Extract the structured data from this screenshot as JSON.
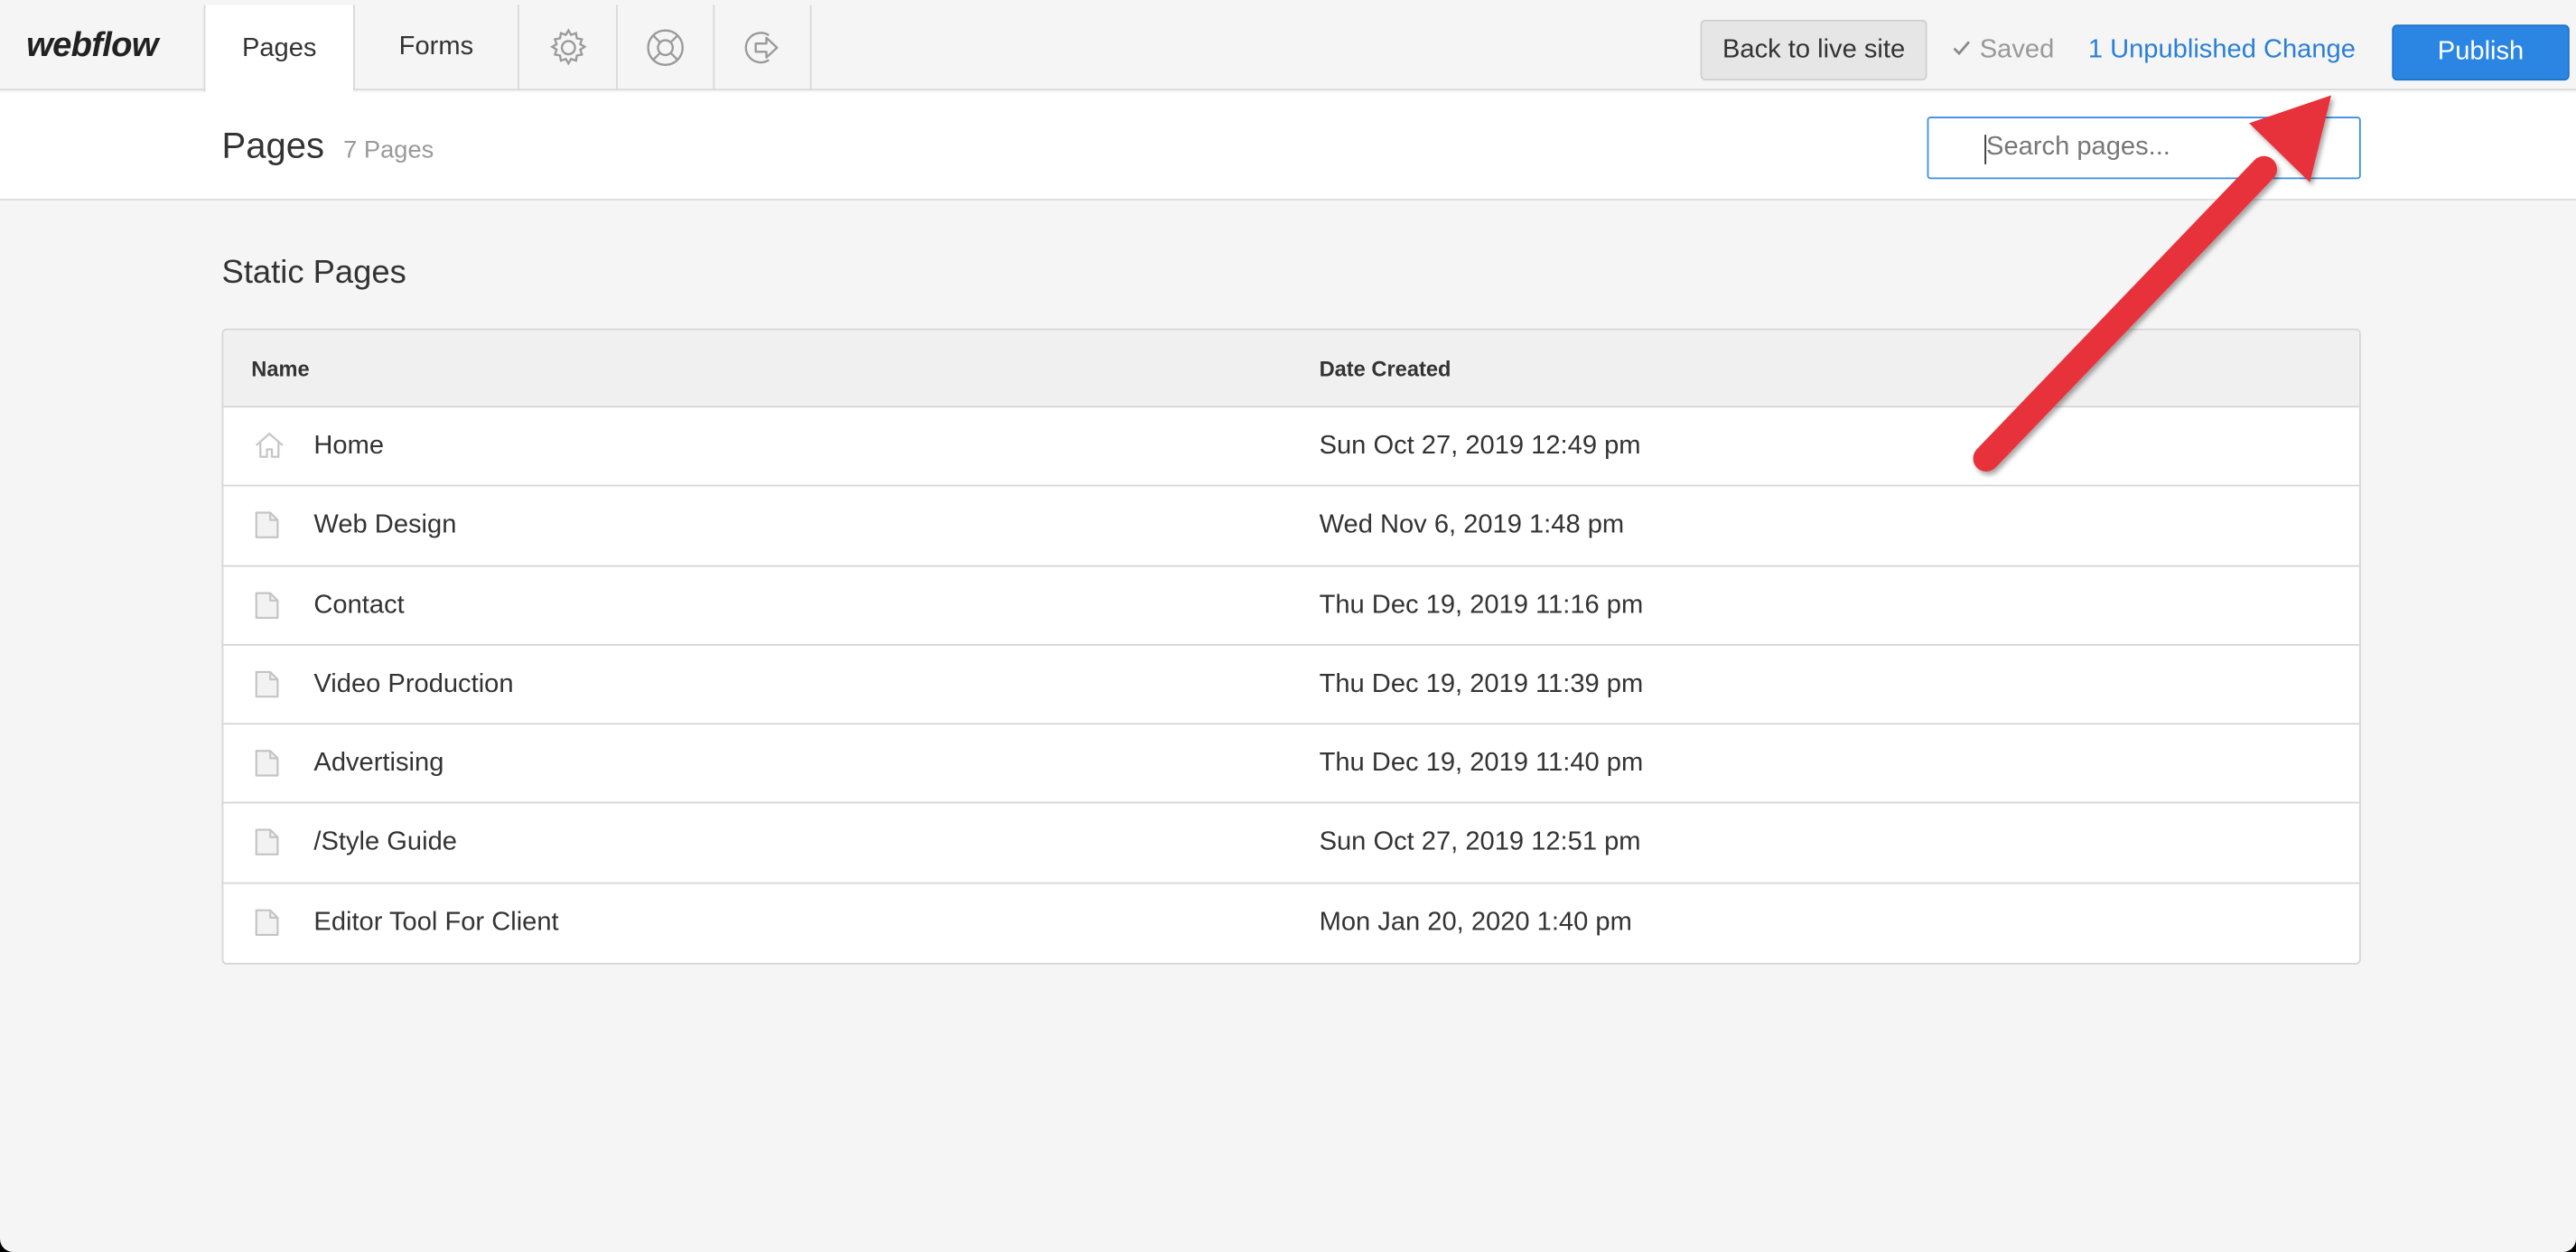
{
  "topbar": {
    "logo": "webflow",
    "tabs": [
      {
        "label": "Pages",
        "active": true
      },
      {
        "label": "Forms",
        "active": false
      }
    ],
    "icon_tabs": [
      "gear-icon",
      "lifebuoy-icon",
      "exit-icon"
    ],
    "back_label": "Back to live site",
    "saved_label": "Saved",
    "unpublished_label": "1 Unpublished Change",
    "publish_label": "Publish"
  },
  "header": {
    "title": "Pages",
    "count": "7 Pages",
    "search_placeholder": "Search pages..."
  },
  "section": {
    "title": "Static Pages",
    "columns": {
      "name": "Name",
      "date": "Date Created"
    },
    "rows": [
      {
        "icon": "home-icon",
        "name": "Home",
        "date": "Sun Oct 27, 2019 12:49 pm"
      },
      {
        "icon": "page-icon",
        "name": "Web Design",
        "date": "Wed Nov 6, 2019 1:48 pm"
      },
      {
        "icon": "page-icon",
        "name": "Contact",
        "date": "Thu Dec 19, 2019 11:16 pm"
      },
      {
        "icon": "page-icon",
        "name": "Video Production",
        "date": "Thu Dec 19, 2019 11:39 pm"
      },
      {
        "icon": "page-icon",
        "name": "Advertising",
        "date": "Thu Dec 19, 2019 11:40 pm"
      },
      {
        "icon": "page-icon",
        "name": "/Style Guide",
        "date": "Sun Oct 27, 2019 12:51 pm"
      },
      {
        "icon": "page-icon",
        "name": "Editor Tool For Client",
        "date": "Mon Jan 20, 2020 1:40 pm"
      }
    ]
  },
  "colors": {
    "accent": "#2b86e3",
    "link": "#2a7fd6",
    "annotation_arrow": "#e8303a"
  }
}
